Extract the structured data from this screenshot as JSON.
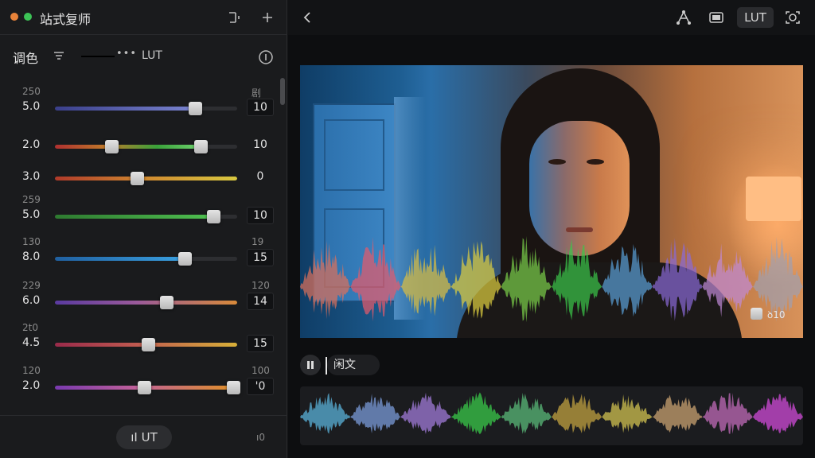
{
  "app": {
    "title": "站式复师",
    "colors": {
      "accent_orange": "#e8833a",
      "accent_green": "#3cc356"
    }
  },
  "left_panel": {
    "header_icons": [
      "window-icon",
      "add-icon"
    ],
    "section_title": "调色",
    "toolbar": {
      "filter_icon": "filter-icon",
      "ellipsis": "•••",
      "lut_label": "LUT",
      "info_icon": "info-icon"
    },
    "rows": [
      {
        "top_left": "250",
        "value": "5.0",
        "level": 0.77,
        "knob2": null,
        "top_right": "剧",
        "right_value": "10",
        "boxed": true,
        "gradient": "linear-gradient(90deg,#3a3f8a,#7a84d0)"
      },
      {
        "top_left": "",
        "value": "2.0",
        "level": 0.8,
        "knob2": 0.31,
        "top_right": "",
        "right_value": "10",
        "boxed": false,
        "gradient": "linear-gradient(90deg,#b03030,#c07a2a 35%,#3aa23a 70%,#6fd36f)"
      },
      {
        "top_left": "",
        "value": "3.0",
        "level": 1.0,
        "knob2": 0.45,
        "top_right": "",
        "right_value": "0",
        "boxed": false,
        "gradient": "linear-gradient(90deg,#b03a2a,#d08a30 50%,#d8c840)"
      },
      {
        "top_left": "259",
        "value": "5.0",
        "level": 0.87,
        "knob2": null,
        "top_right": "",
        "right_value": "10",
        "boxed": true,
        "gradient": "linear-gradient(90deg,#2e7a30,#4fc050)"
      },
      {
        "top_left": "130",
        "value": "8.0",
        "level": 0.71,
        "knob2": null,
        "top_right": "19",
        "right_value": "15",
        "boxed": true,
        "gradient": "linear-gradient(90deg,#2060a0,#3aa0e0)"
      },
      {
        "top_left": "229",
        "value": "6.0",
        "level": 1.0,
        "knob2": 0.61,
        "top_right": "120",
        "right_value": "14",
        "boxed": true,
        "gradient": "linear-gradient(90deg,#5a3aa0,#9a5a9a 45%,#d88a3a)"
      },
      {
        "top_left": "2t0",
        "value": "4.5",
        "level": 1.0,
        "knob2": 0.51,
        "top_right": "",
        "right_value": "15",
        "boxed": true,
        "gradient": "linear-gradient(90deg,#9a2a4a,#c05a50 45%,#d8b038)"
      },
      {
        "top_left": "120",
        "value": "2.0",
        "level": 0.98,
        "knob2": 0.49,
        "top_right": "100",
        "right_value": "'0",
        "boxed": true,
        "gradient": "linear-gradient(90deg,#7a3ab0,#c0609a 45%,#e0902a)"
      }
    ],
    "bottom": {
      "lut_button": "ıI UT",
      "right_text": "ı0"
    }
  },
  "right_panel": {
    "header": {
      "back_icon": "back-icon",
      "icons": [
        "nodes-icon",
        "frame-icon"
      ],
      "lut_chip": "LUT",
      "capture_icon": "capture-icon"
    },
    "video": {
      "overlay_value": "ꝺ10",
      "overlay_level": 0.91
    },
    "controls": {
      "pause_icon": "pause-icon",
      "pill_text": "闲文"
    },
    "timeline": {
      "label": ""
    }
  }
}
